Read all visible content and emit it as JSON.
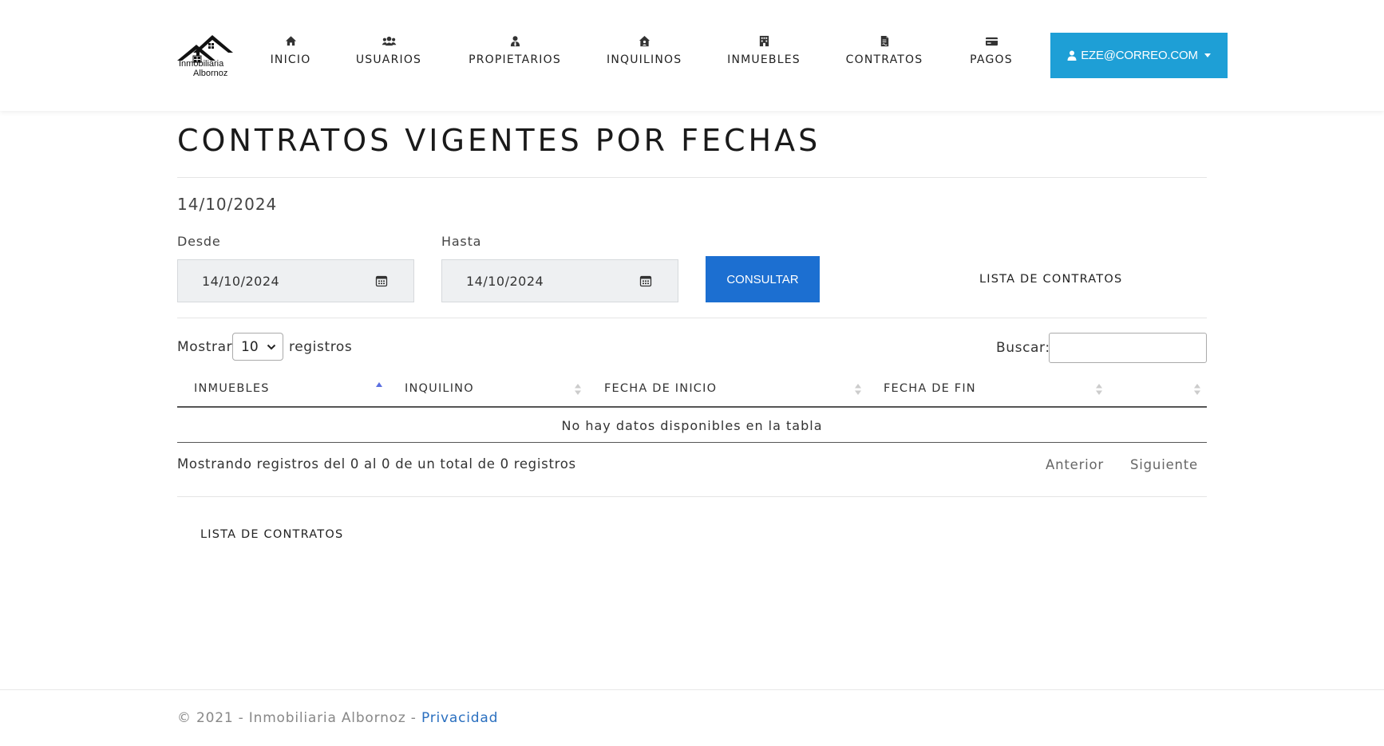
{
  "brand": {
    "line1": "Inmobiliaria",
    "line2": "Albornoz"
  },
  "nav": {
    "items": [
      {
        "label": "INICIO",
        "icon": "home-icon"
      },
      {
        "label": "USUARIOS",
        "icon": "users-icon"
      },
      {
        "label": "PROPIETARIOS",
        "icon": "user-tie-icon"
      },
      {
        "label": "INQUILINOS",
        "icon": "house-user-icon"
      },
      {
        "label": "INMUEBLES",
        "icon": "building-icon"
      },
      {
        "label": "CONTRATOS",
        "icon": "file-contract-icon"
      },
      {
        "label": "PAGOS",
        "icon": "credit-card-icon"
      }
    ],
    "user": {
      "label": "EZE@CORREO.COM",
      "icon": "user-icon"
    }
  },
  "page": {
    "title": "CONTRATOS VIGENTES POR FECHAS",
    "today": "14/10/2024"
  },
  "filters": {
    "desde_label": "Desde",
    "desde_value": "14/10/2024",
    "hasta_label": "Hasta",
    "hasta_value": "14/10/2024",
    "consultar_label": "CONSULTAR",
    "lista_label": "LISTA DE CONTRATOS"
  },
  "table": {
    "show_prefix": "Mostrar",
    "page_length": "10",
    "show_suffix": "registros",
    "search_label": "Buscar:",
    "search_value": "",
    "columns": [
      "INMUEBLES",
      "INQUILINO",
      "FECHA DE INICIO",
      "FECHA DE FIN",
      ""
    ],
    "sorted_column": "INMUEBLES",
    "empty_message": "No hay datos disponibles en la tabla",
    "info": "Mostrando registros del 0 al 0 de un total de 0 registros",
    "prev_label": "Anterior",
    "next_label": "Siguiente"
  },
  "bottom_link": "LISTA DE CONTRATOS",
  "footer": {
    "text": "© 2021 - Inmobiliaria Albornoz - ",
    "link": "Privacidad"
  },
  "colors": {
    "user_button": "#1e9fd6",
    "consultar_button": "#1c6fd1",
    "sort_active": "#5b6fe0",
    "footer_link": "#2a6fbf"
  }
}
